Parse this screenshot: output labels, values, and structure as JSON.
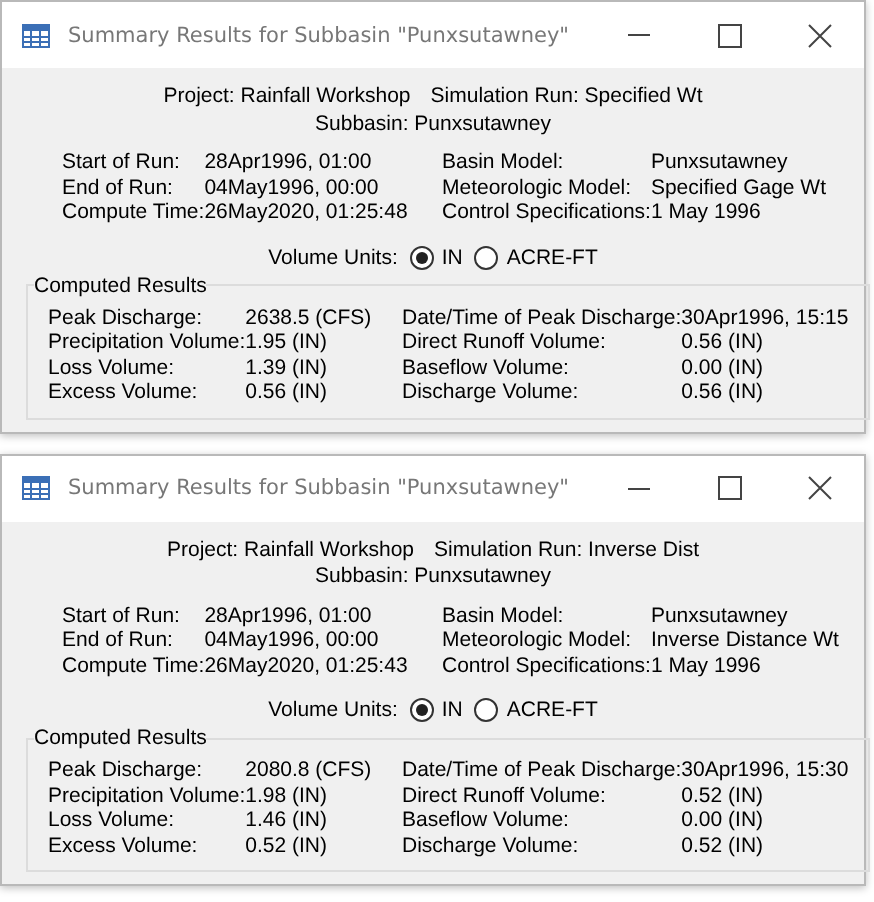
{
  "windows": [
    {
      "title": "Summary Results for Subbasin \"Punxsutawney\"",
      "header": [
        {
          "label": "Project:",
          "value": "Rainfall Workshop"
        },
        {
          "label": "Simulation Run:",
          "value": "Specified Wt"
        },
        {
          "label": "Subbasin:",
          "value": "Punxsutawney"
        }
      ],
      "run_info_left": [
        {
          "label": "Start of Run:",
          "value": "28Apr1996, 01:00"
        },
        {
          "label": "End of Run:",
          "value": "04May1996, 00:00"
        },
        {
          "label": "Compute Time:",
          "value": "26May2020, 01:25:48"
        }
      ],
      "run_info_right": [
        {
          "label": "Basin Model:",
          "value": "Punxsutawney"
        },
        {
          "label": "Meteorologic Model:",
          "value": "Specified Gage Wt"
        },
        {
          "label": "Control Specifications:",
          "value": "1 May 1996"
        }
      ],
      "volume_units": {
        "label": "Volume Units:",
        "options": [
          {
            "label": "IN",
            "selected": true
          },
          {
            "label": "ACRE-FT",
            "selected": false
          }
        ]
      },
      "computed_results": {
        "title": "Computed Results",
        "left": [
          {
            "label": "Peak Discharge:",
            "value": "2638.5 (CFS)"
          },
          {
            "label": "Precipitation Volume:",
            "value": "1.95 (IN)"
          },
          {
            "label": "Loss Volume:",
            "value": "1.39 (IN)"
          },
          {
            "label": "Excess Volume:",
            "value": "0.56 (IN)"
          }
        ],
        "right": [
          {
            "label": "Date/Time of Peak Discharge:",
            "value": "30Apr1996, 15:15"
          },
          {
            "label": "Direct Runoff Volume:",
            "value": "0.56 (IN)"
          },
          {
            "label": "Baseflow Volume:",
            "value": "0.00 (IN)"
          },
          {
            "label": "Discharge Volume:",
            "value": "0.56 (IN)"
          }
        ]
      }
    },
    {
      "title": "Summary Results for Subbasin \"Punxsutawney\"",
      "header": [
        {
          "label": "Project:",
          "value": "Rainfall Workshop"
        },
        {
          "label": "Simulation Run:",
          "value": "Inverse Dist"
        },
        {
          "label": "Subbasin:",
          "value": "Punxsutawney"
        }
      ],
      "run_info_left": [
        {
          "label": "Start of Run:",
          "value": "28Apr1996, 01:00"
        },
        {
          "label": "End of Run:",
          "value": "04May1996, 00:00"
        },
        {
          "label": "Compute Time:",
          "value": "26May2020, 01:25:43"
        }
      ],
      "run_info_right": [
        {
          "label": "Basin Model:",
          "value": "Punxsutawney"
        },
        {
          "label": "Meteorologic Model:",
          "value": "Inverse Distance Wt"
        },
        {
          "label": "Control Specifications:",
          "value": "1 May 1996"
        }
      ],
      "volume_units": {
        "label": "Volume Units:",
        "options": [
          {
            "label": "IN",
            "selected": true
          },
          {
            "label": "ACRE-FT",
            "selected": false
          }
        ]
      },
      "computed_results": {
        "title": "Computed Results",
        "left": [
          {
            "label": "Peak Discharge:",
            "value": "2080.8 (CFS)"
          },
          {
            "label": "Precipitation Volume:",
            "value": "1.98 (IN)"
          },
          {
            "label": "Loss Volume:",
            "value": "1.46 (IN)"
          },
          {
            "label": "Excess Volume:",
            "value": "0.52 (IN)"
          }
        ],
        "right": [
          {
            "label": "Date/Time of Peak Discharge:",
            "value": "30Apr1996, 15:30"
          },
          {
            "label": "Direct Runoff Volume:",
            "value": "0.52 (IN)"
          },
          {
            "label": "Baseflow Volume:",
            "value": "0.00 (IN)"
          },
          {
            "label": "Discharge Volume:",
            "value": "0.52 (IN)"
          }
        ]
      }
    }
  ]
}
